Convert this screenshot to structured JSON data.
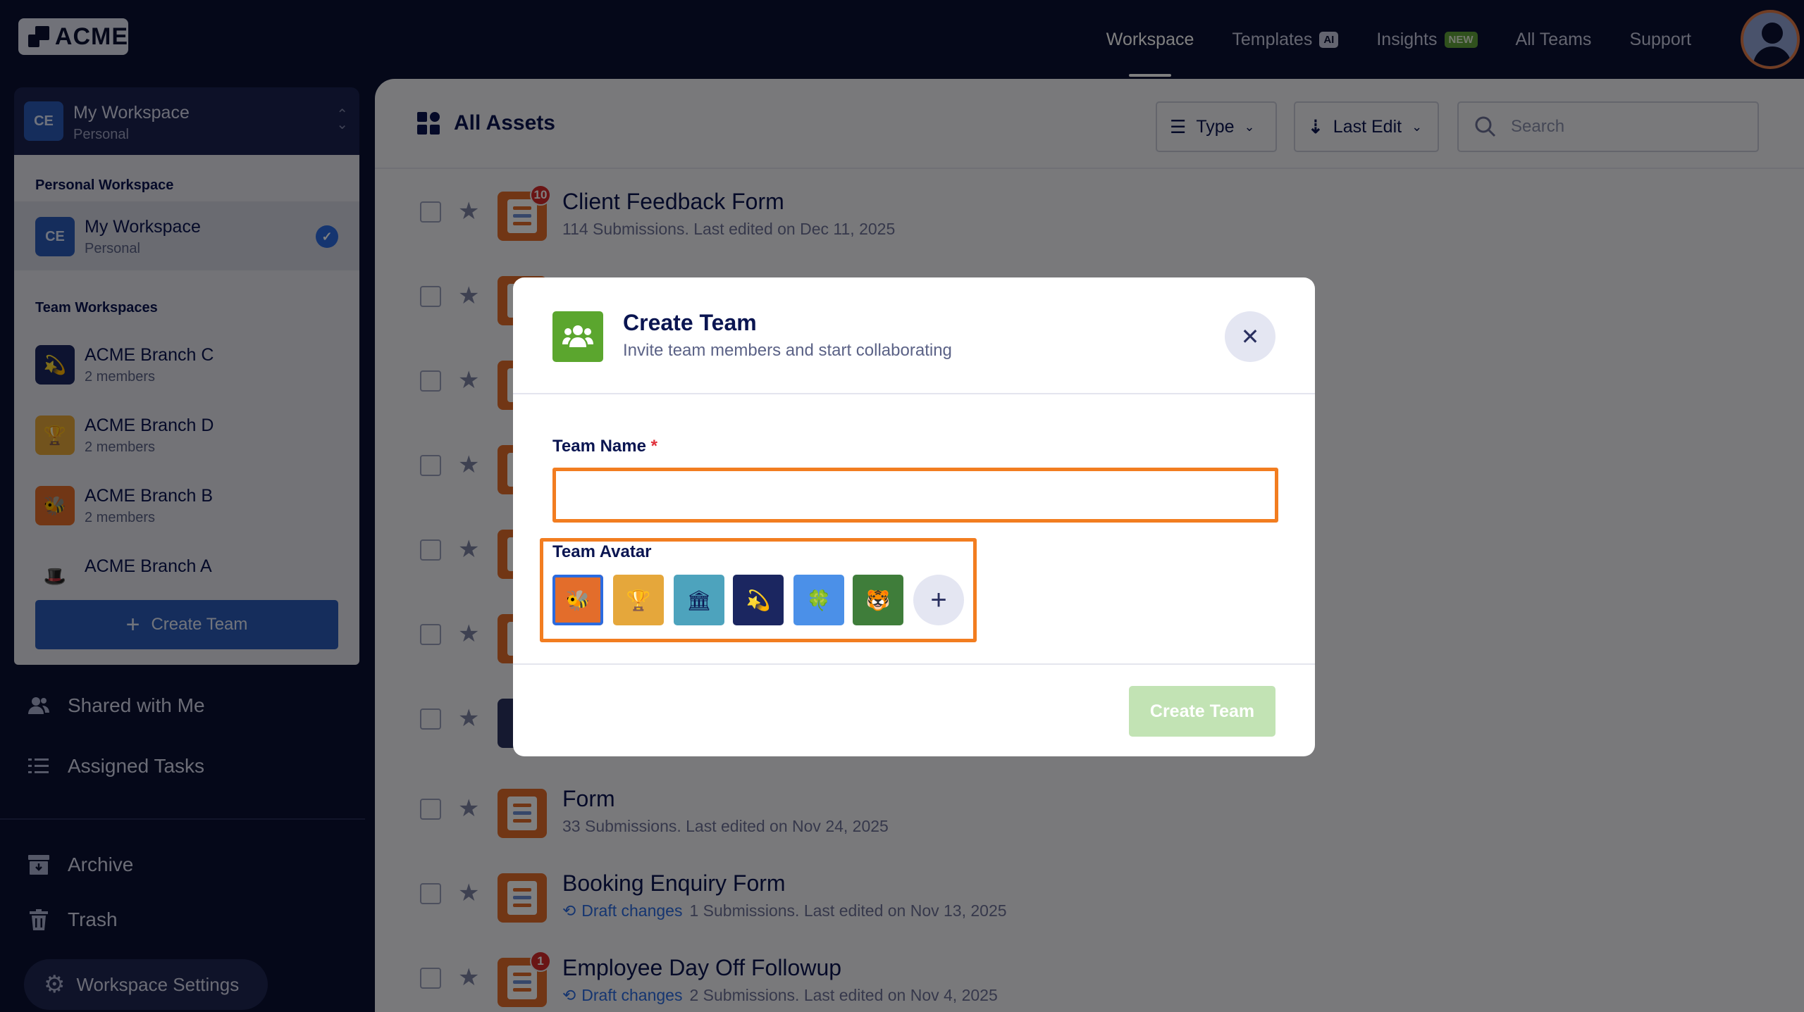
{
  "topbar": {
    "logo_text": "ACME",
    "nav": [
      {
        "label": "Workspace",
        "active": true
      },
      {
        "label": "Templates",
        "badge": "AI"
      },
      {
        "label": "Insights",
        "badge": "NEW"
      },
      {
        "label": "All Teams"
      },
      {
        "label": "Support"
      }
    ]
  },
  "sidebar": {
    "switcher": {
      "initials": "CE",
      "name": "My Workspace",
      "type": "Personal"
    },
    "dropdown": {
      "personal_heading": "Personal Workspace",
      "personal_item": {
        "initials": "CE",
        "name": "My Workspace",
        "type": "Personal"
      },
      "team_heading": "Team Workspaces",
      "teams": [
        {
          "name": "ACME Branch C",
          "members": "2 members",
          "icon": "comet-icon",
          "glyph": "💫",
          "color": "#1b2660"
        },
        {
          "name": "ACME Branch D",
          "members": "2 members",
          "icon": "trophy-icon",
          "glyph": "🏆",
          "color": "#e5a73b"
        },
        {
          "name": "ACME Branch B",
          "members": "2 members",
          "icon": "bee-icon",
          "glyph": "🐝",
          "color": "#e36d2b"
        },
        {
          "name": "ACME Branch A",
          "members": "",
          "icon": "hat-icon",
          "glyph": "🎩",
          "color": "#e6e7ef"
        }
      ],
      "create_button": "Create Team"
    },
    "links": [
      {
        "label": "Shared with Me",
        "icon": "users-icon"
      },
      {
        "label": "Assigned Tasks",
        "icon": "tasks-icon"
      }
    ],
    "links2": [
      {
        "label": "Archive",
        "icon": "archive-icon"
      },
      {
        "label": "Trash",
        "icon": "trash-icon"
      }
    ],
    "settings_label": "Workspace Settings"
  },
  "main": {
    "title": "All Assets",
    "filter_type": "Type",
    "sort": "Last Edit",
    "search_placeholder": "Search",
    "rows": [
      {
        "title": "Client Feedback Form",
        "meta": "114 Submissions. Last edited on Dec 11, 2025",
        "count": "10",
        "draft": ""
      },
      {
        "title": "Form",
        "meta": "33 Submissions. Last edited on Nov 24, 2025",
        "count": "",
        "draft": ""
      },
      {
        "title": "Booking Enquiry Form",
        "meta": "1 Submissions. Last edited on Nov 13, 2025",
        "count": "",
        "draft": "Draft changes"
      },
      {
        "title": "Employee Day Off Followup",
        "meta": "2 Submissions. Last edited on Nov 4, 2025",
        "count": "1",
        "draft": "Draft changes"
      }
    ]
  },
  "modal": {
    "title": "Create Team",
    "subtitle": "Invite team members and start collaborating",
    "name_label": "Team Name",
    "required_mark": "*",
    "name_value": "",
    "avatar_label": "Team Avatar",
    "avatars": [
      {
        "icon": "bee-icon",
        "glyph": "🐝",
        "color": "#e36d2b",
        "selected": true
      },
      {
        "icon": "trophy-icon",
        "glyph": "🏆",
        "color": "#e5a73b"
      },
      {
        "icon": "bank-icon",
        "glyph": "🏛",
        "color": "#4da3bd"
      },
      {
        "icon": "comet-icon",
        "glyph": "💫",
        "color": "#1b2660"
      },
      {
        "icon": "clover-icon",
        "glyph": "🍀",
        "color": "#4b90e8"
      },
      {
        "icon": "tiger-icon",
        "glyph": "🐯",
        "color": "#3f7d3a"
      }
    ],
    "create_button": "Create Team"
  }
}
